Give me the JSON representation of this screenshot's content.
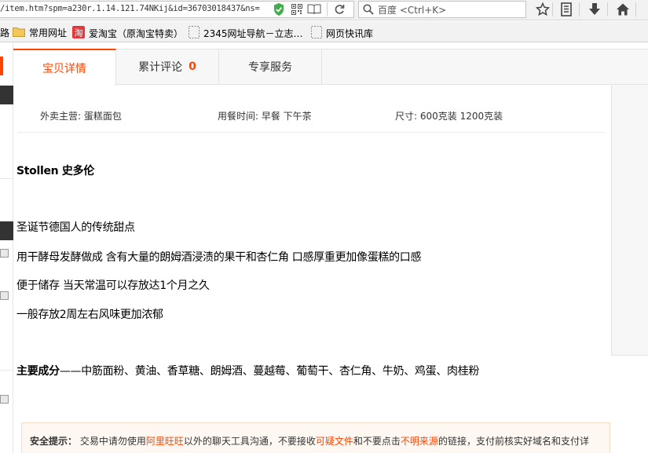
{
  "browser": {
    "url": "/item.htm?spm=a230r.1.14.121.74NKij&id=36703018437&ns=",
    "search_placeholder": "百度 <Ctrl+K>",
    "bookmarks": [
      {
        "label": "路",
        "icon": "none"
      },
      {
        "label": "常用网址",
        "icon": "folder-icon"
      },
      {
        "label": "爱淘宝（原淘宝特卖）",
        "icon": "taobao-icon"
      },
      {
        "label": "2345网址导航－立志…",
        "icon": "page-icon"
      },
      {
        "label": "网页快讯库",
        "icon": "page-icon"
      }
    ]
  },
  "tabs": [
    {
      "label": "宝贝详情",
      "count": ""
    },
    {
      "label": "累计评论",
      "count": "0"
    },
    {
      "label": "专享服务",
      "count": ""
    }
  ],
  "attributes": [
    "外卖主营: 蛋糕面包",
    "用餐时间: 早餐 下午茶",
    "尺寸: 600克装 1200克装"
  ],
  "description": {
    "title": "Stollen 史多伦",
    "lines": [
      "圣诞节德国人的传统甜点",
      "用干酵母发酵做成 含有大量的朗姆酒浸渍的果干和杏仁角 口感厚重更加像蛋糕的口感",
      "便于储存 当天常温可以存放达1个月之久",
      "一般存放2周左右风味更加浓郁"
    ],
    "ingredients_label": "主要成分",
    "ingredients": "——中筋面粉、黄油、香草糖、朗姆酒、蔓越莓、葡萄干、杏仁角、牛奶、鸡蛋、肉桂粉"
  },
  "safety": {
    "label": "安全提示：",
    "part1": "交易中请勿使用",
    "link1": "阿里旺旺",
    "part2": "以外的聊天工具沟通，不要接收",
    "link2": "可疑文件",
    "part3": "和不要点击",
    "link3": "不明来源",
    "part4": "的链接，支付前核实好域名和支付详"
  },
  "colors": {
    "accent": "#ff4400",
    "tab_bg": "#f7f7f7",
    "safety_bg": "#fff8f2"
  }
}
